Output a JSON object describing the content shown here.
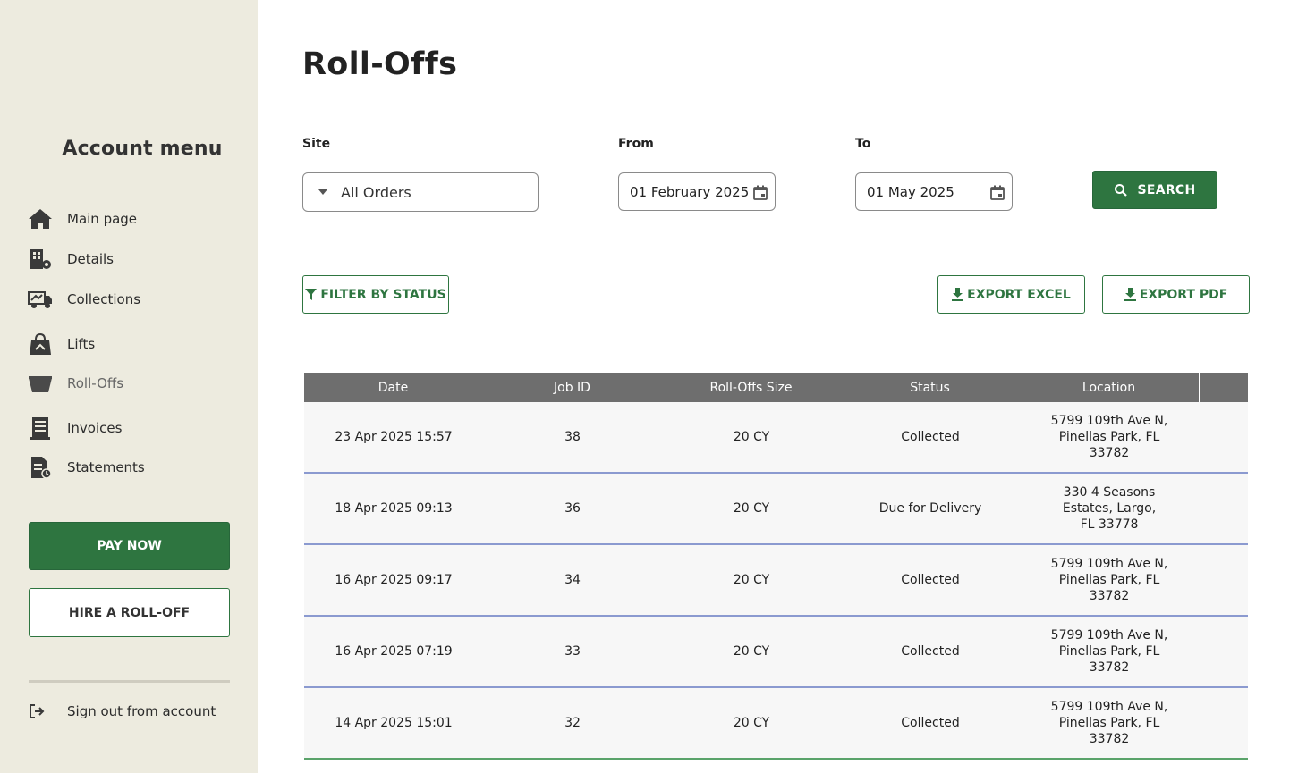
{
  "sidebar": {
    "title": "Account menu",
    "items": [
      {
        "label": "Main page",
        "icon": "home-icon"
      },
      {
        "label": "Details",
        "icon": "building-gear-icon"
      },
      {
        "label": "Collections",
        "icon": "truck-icon"
      },
      {
        "label": "Lifts",
        "icon": "lift-bag-icon"
      },
      {
        "label": "Roll-Offs",
        "icon": "dumpster-icon",
        "active": true
      },
      {
        "label": "Invoices",
        "icon": "invoice-icon"
      },
      {
        "label": "Statements",
        "icon": "statement-icon"
      }
    ],
    "pay_now": "PAY NOW",
    "hire": "HIRE A ROLL-OFF",
    "sign_out": "Sign out from account"
  },
  "main": {
    "title": "Roll-Offs",
    "filters": {
      "site_label": "Site",
      "site_value": "All Orders",
      "from_label": "From",
      "from_value": "01 February 2025",
      "to_label": "To",
      "to_value": "01 May 2025",
      "search": "SEARCH"
    },
    "actions": {
      "filter_status": "FILTER BY STATUS",
      "export_excel": "EXPORT EXCEL",
      "export_pdf": "EXPORT PDF"
    },
    "table": {
      "columns": [
        "Date",
        "Job ID",
        "Roll-Offs Size",
        "Status",
        "Location"
      ],
      "rows": [
        {
          "date": "23 Apr 2025 15:57",
          "job_id": "38",
          "size": "20 CY",
          "status": "Collected",
          "location": "5799 109th Ave N, Pinellas Park, FL 33782"
        },
        {
          "date": "18 Apr 2025 09:13",
          "job_id": "36",
          "size": "20 CY",
          "status": "Due for Delivery",
          "location": "330 4 Seasons Estates, Largo, FL 33778"
        },
        {
          "date": "16 Apr 2025 09:17",
          "job_id": "34",
          "size": "20 CY",
          "status": "Collected",
          "location": "5799 109th Ave N, Pinellas Park, FL 33782"
        },
        {
          "date": "16 Apr 2025 07:19",
          "job_id": "33",
          "size": "20 CY",
          "status": "Collected",
          "location": "5799 109th Ave N, Pinellas Park, FL 33782"
        },
        {
          "date": "14 Apr 2025 15:01",
          "job_id": "32",
          "size": "20 CY",
          "status": "Collected",
          "location": "5799 109th Ave N, Pinellas Park, FL 33782"
        }
      ]
    }
  },
  "colors": {
    "sidebar_bg": "#edebdf",
    "brand_green": "#2e7540",
    "table_header": "#6e6e6e",
    "row_divider": "#8b9ad0"
  }
}
